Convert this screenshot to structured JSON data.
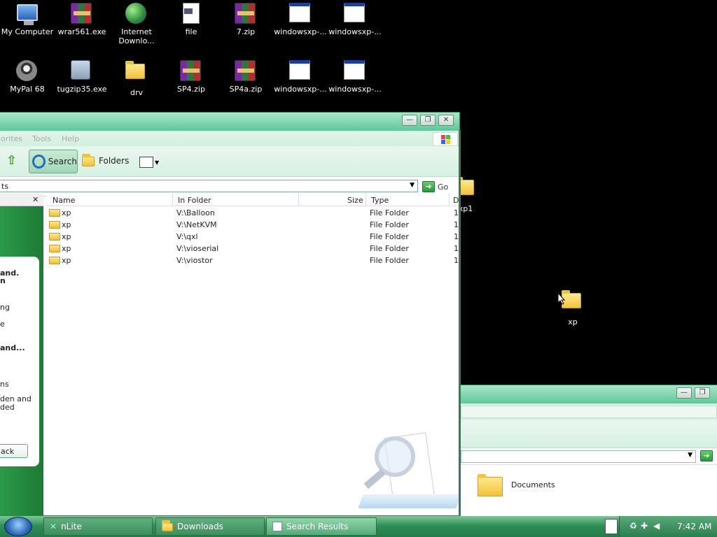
{
  "desktop": {
    "icons": [
      {
        "label": "My Computer",
        "icon": "computer-icon"
      },
      {
        "label": "wrar561.exe",
        "icon": "winrar-icon"
      },
      {
        "label": "Internet Downlo...",
        "icon": "idm-icon"
      },
      {
        "label": "file",
        "icon": "file-icon"
      },
      {
        "label": "7.zip",
        "icon": "winrar-icon"
      },
      {
        "label": "windowsxp-...",
        "icon": "window-file-icon"
      },
      {
        "label": "windowsxp-...",
        "icon": "window-file-icon"
      },
      {
        "label": "MyPal 68",
        "icon": "mypal-icon"
      },
      {
        "label": "tugzip35.exe",
        "icon": "setup-icon"
      },
      {
        "label": "drv",
        "icon": "folder-icon"
      },
      {
        "label": "SP4.zip",
        "icon": "winrar-icon"
      },
      {
        "label": "SP4a.zip",
        "icon": "winrar-icon"
      },
      {
        "label": "windowsxp-...",
        "icon": "window-file-icon"
      },
      {
        "label": "windowsxp-...",
        "icon": "window-file-icon"
      },
      {
        "label": "xp1",
        "icon": "folder-icon"
      },
      {
        "label": "xp",
        "icon": "folder-icon"
      }
    ]
  },
  "search_window": {
    "menu": [
      "orites",
      "Tools",
      "Help"
    ],
    "toolbar": {
      "search": "Search",
      "folders": "Folders"
    },
    "address": "ts",
    "go": "Go",
    "columns": [
      "Name",
      "In Folder",
      "Size",
      "Type",
      "D"
    ],
    "rows": [
      {
        "name": "xp",
        "folder": "V:\\Balloon",
        "type": "File Folder",
        "date": "1"
      },
      {
        "name": "xp",
        "folder": "V:\\NetKVM",
        "type": "File Folder",
        "date": "1"
      },
      {
        "name": "xp",
        "folder": "V:\\qxl",
        "type": "File Folder",
        "date": "1"
      },
      {
        "name": "xp",
        "folder": "V:\\vioserial",
        "type": "File Folder",
        "date": "1"
      },
      {
        "name": "xp",
        "folder": "V:\\viostor",
        "type": "File Folder",
        "date": "1"
      }
    ],
    "left_panel": {
      "close": "✕",
      "texts": [
        "and.",
        "n",
        "ng",
        "e",
        "and...",
        "ns",
        "den and",
        "ded",
        "ack"
      ]
    }
  },
  "second_window": {
    "item": "Documents"
  },
  "taskbar": {
    "buttons": [
      {
        "label": "nLite"
      },
      {
        "label": "Downloads"
      },
      {
        "label": "Search Results"
      }
    ],
    "clock": "7:42 AM"
  }
}
